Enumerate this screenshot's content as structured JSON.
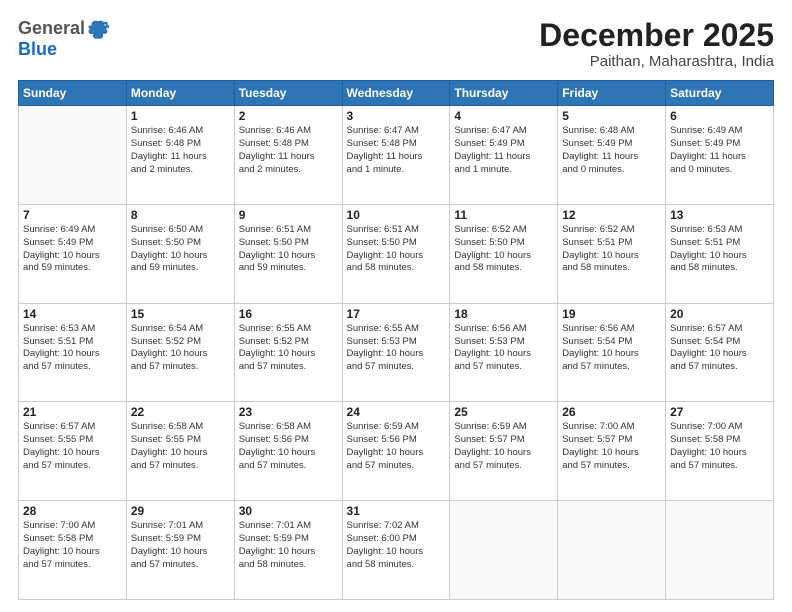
{
  "header": {
    "logo_line1": "General",
    "logo_line2": "Blue",
    "month": "December 2025",
    "location": "Paithan, Maharashtra, India"
  },
  "weekdays": [
    "Sunday",
    "Monday",
    "Tuesday",
    "Wednesday",
    "Thursday",
    "Friday",
    "Saturday"
  ],
  "weeks": [
    [
      {
        "day": "",
        "info": ""
      },
      {
        "day": "1",
        "info": "Sunrise: 6:46 AM\nSunset: 5:48 PM\nDaylight: 11 hours\nand 2 minutes."
      },
      {
        "day": "2",
        "info": "Sunrise: 6:46 AM\nSunset: 5:48 PM\nDaylight: 11 hours\nand 2 minutes."
      },
      {
        "day": "3",
        "info": "Sunrise: 6:47 AM\nSunset: 5:48 PM\nDaylight: 11 hours\nand 1 minute."
      },
      {
        "day": "4",
        "info": "Sunrise: 6:47 AM\nSunset: 5:49 PM\nDaylight: 11 hours\nand 1 minute."
      },
      {
        "day": "5",
        "info": "Sunrise: 6:48 AM\nSunset: 5:49 PM\nDaylight: 11 hours\nand 0 minutes."
      },
      {
        "day": "6",
        "info": "Sunrise: 6:49 AM\nSunset: 5:49 PM\nDaylight: 11 hours\nand 0 minutes."
      }
    ],
    [
      {
        "day": "7",
        "info": "Sunrise: 6:49 AM\nSunset: 5:49 PM\nDaylight: 10 hours\nand 59 minutes."
      },
      {
        "day": "8",
        "info": "Sunrise: 6:50 AM\nSunset: 5:50 PM\nDaylight: 10 hours\nand 59 minutes."
      },
      {
        "day": "9",
        "info": "Sunrise: 6:51 AM\nSunset: 5:50 PM\nDaylight: 10 hours\nand 59 minutes."
      },
      {
        "day": "10",
        "info": "Sunrise: 6:51 AM\nSunset: 5:50 PM\nDaylight: 10 hours\nand 58 minutes."
      },
      {
        "day": "11",
        "info": "Sunrise: 6:52 AM\nSunset: 5:50 PM\nDaylight: 10 hours\nand 58 minutes."
      },
      {
        "day": "12",
        "info": "Sunrise: 6:52 AM\nSunset: 5:51 PM\nDaylight: 10 hours\nand 58 minutes."
      },
      {
        "day": "13",
        "info": "Sunrise: 6:53 AM\nSunset: 5:51 PM\nDaylight: 10 hours\nand 58 minutes."
      }
    ],
    [
      {
        "day": "14",
        "info": "Sunrise: 6:53 AM\nSunset: 5:51 PM\nDaylight: 10 hours\nand 57 minutes."
      },
      {
        "day": "15",
        "info": "Sunrise: 6:54 AM\nSunset: 5:52 PM\nDaylight: 10 hours\nand 57 minutes."
      },
      {
        "day": "16",
        "info": "Sunrise: 6:55 AM\nSunset: 5:52 PM\nDaylight: 10 hours\nand 57 minutes."
      },
      {
        "day": "17",
        "info": "Sunrise: 6:55 AM\nSunset: 5:53 PM\nDaylight: 10 hours\nand 57 minutes."
      },
      {
        "day": "18",
        "info": "Sunrise: 6:56 AM\nSunset: 5:53 PM\nDaylight: 10 hours\nand 57 minutes."
      },
      {
        "day": "19",
        "info": "Sunrise: 6:56 AM\nSunset: 5:54 PM\nDaylight: 10 hours\nand 57 minutes."
      },
      {
        "day": "20",
        "info": "Sunrise: 6:57 AM\nSunset: 5:54 PM\nDaylight: 10 hours\nand 57 minutes."
      }
    ],
    [
      {
        "day": "21",
        "info": "Sunrise: 6:57 AM\nSunset: 5:55 PM\nDaylight: 10 hours\nand 57 minutes."
      },
      {
        "day": "22",
        "info": "Sunrise: 6:58 AM\nSunset: 5:55 PM\nDaylight: 10 hours\nand 57 minutes."
      },
      {
        "day": "23",
        "info": "Sunrise: 6:58 AM\nSunset: 5:56 PM\nDaylight: 10 hours\nand 57 minutes."
      },
      {
        "day": "24",
        "info": "Sunrise: 6:59 AM\nSunset: 5:56 PM\nDaylight: 10 hours\nand 57 minutes."
      },
      {
        "day": "25",
        "info": "Sunrise: 6:59 AM\nSunset: 5:57 PM\nDaylight: 10 hours\nand 57 minutes."
      },
      {
        "day": "26",
        "info": "Sunrise: 7:00 AM\nSunset: 5:57 PM\nDaylight: 10 hours\nand 57 minutes."
      },
      {
        "day": "27",
        "info": "Sunrise: 7:00 AM\nSunset: 5:58 PM\nDaylight: 10 hours\nand 57 minutes."
      }
    ],
    [
      {
        "day": "28",
        "info": "Sunrise: 7:00 AM\nSunset: 5:58 PM\nDaylight: 10 hours\nand 57 minutes."
      },
      {
        "day": "29",
        "info": "Sunrise: 7:01 AM\nSunset: 5:59 PM\nDaylight: 10 hours\nand 57 minutes."
      },
      {
        "day": "30",
        "info": "Sunrise: 7:01 AM\nSunset: 5:59 PM\nDaylight: 10 hours\nand 58 minutes."
      },
      {
        "day": "31",
        "info": "Sunrise: 7:02 AM\nSunset: 6:00 PM\nDaylight: 10 hours\nand 58 minutes."
      },
      {
        "day": "",
        "info": ""
      },
      {
        "day": "",
        "info": ""
      },
      {
        "day": "",
        "info": ""
      }
    ]
  ]
}
